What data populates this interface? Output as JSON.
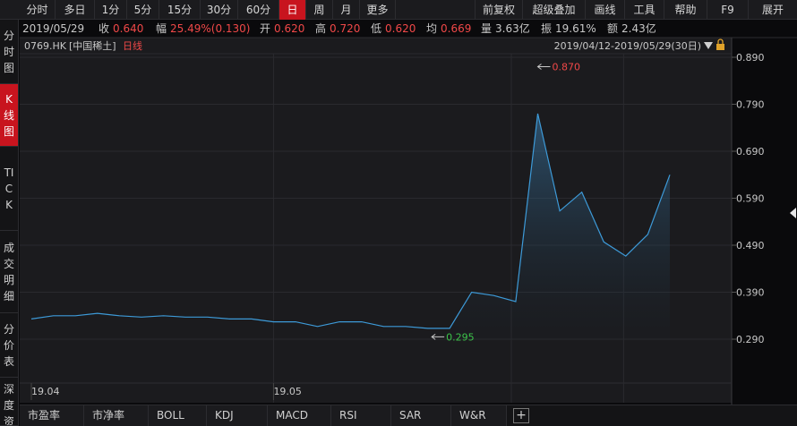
{
  "toolbar": {
    "left_items": [
      "分时",
      "多日",
      "1分",
      "5分",
      "15分",
      "30分",
      "60分",
      "日",
      "周",
      "月",
      "更多"
    ],
    "active_index": 7,
    "right_items": [
      "前复权",
      "超级叠加",
      "画线",
      "工具",
      "帮助",
      "F9",
      "展开"
    ]
  },
  "side_tabs": [
    {
      "label": "分时图",
      "active": false
    },
    {
      "label": "K线图",
      "active": true
    },
    {
      "label": "TICK",
      "active": false
    },
    {
      "label": "成交明细",
      "active": false
    },
    {
      "label": "分价表",
      "active": false
    },
    {
      "label": "深度资",
      "active": false
    }
  ],
  "info": {
    "date": "2019/05/29",
    "close_label": "收",
    "close": "0.640",
    "amp_label": "幅",
    "amp": "25.49%(0.130)",
    "open_label": "开",
    "open": "0.620",
    "high_label": "高",
    "high": "0.720",
    "low_label": "低",
    "low": "0.620",
    "avg_label": "均",
    "avg": "0.669",
    "vol_label": "量",
    "vol": "3.63亿",
    "swing_label": "振",
    "swing": "19.61%",
    "turnover_label": "额",
    "turnover": "2.43亿"
  },
  "chart_header": {
    "code": "0769.HK",
    "name": "[中国稀土]",
    "period": "日线",
    "range": "2019/04/12-2019/05/29(30日)"
  },
  "colors": {
    "line": "#3d9ad8",
    "up": "#f04848",
    "down": "#3cc34a",
    "active_tab": "#c8141e"
  },
  "chart_data": {
    "type": "area",
    "x_tick_labels": [
      "19.04",
      "19.05"
    ],
    "y_tick_labels": [
      "0.890",
      "0.790",
      "0.690",
      "0.590",
      "0.490",
      "0.390",
      "0.290"
    ],
    "ylim": [
      0.24,
      0.93
    ],
    "series": [
      {
        "values": [
          0.333,
          0.34,
          0.34,
          0.345,
          0.34,
          0.337,
          0.34,
          0.337,
          0.337,
          0.333,
          0.333,
          0.327,
          0.327,
          0.317,
          0.327,
          0.327,
          0.317,
          0.317,
          0.313,
          0.313,
          0.39,
          0.383,
          0.37,
          0.77,
          0.563,
          0.603,
          0.497,
          0.467,
          0.513,
          0.64
        ]
      }
    ],
    "annotations": [
      {
        "label": "0.870",
        "kind": "high"
      },
      {
        "label": "0.295",
        "kind": "low"
      }
    ]
  },
  "bottom_tabs": [
    "市盈率",
    "市净率",
    "BOLL",
    "KDJ",
    "MACD",
    "RSI",
    "SAR",
    "W&R"
  ],
  "add_tab_label": "+"
}
